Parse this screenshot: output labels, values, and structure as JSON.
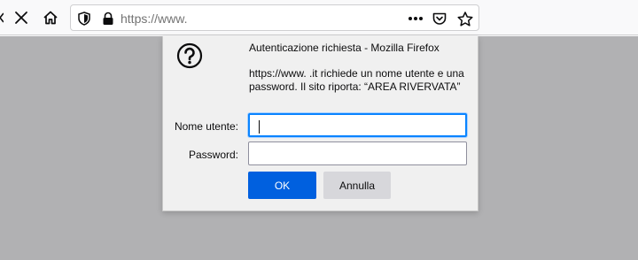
{
  "toolbar": {
    "url": "https://www.",
    "icons": [
      "back-icon",
      "stop-icon",
      "home-icon",
      "tracking-shield-icon",
      "lock-icon",
      "page-actions-icon",
      "pocket-icon",
      "bookmark-star-icon"
    ]
  },
  "dialog": {
    "title": "Autenticazione richiesta - Mozilla Firefox",
    "message": "https://www.              .it richiede un nome utente e una password. Il sito riporta: “AREA RIVERVATA”",
    "username_label": "Nome utente:",
    "username_value": "",
    "password_label": "Password:",
    "password_value": "",
    "ok_label": "OK",
    "cancel_label": "Annulla"
  },
  "colors": {
    "accent": "#0060df",
    "focus_ring": "#0a84ff",
    "content_bg": "#b1b1b3"
  }
}
